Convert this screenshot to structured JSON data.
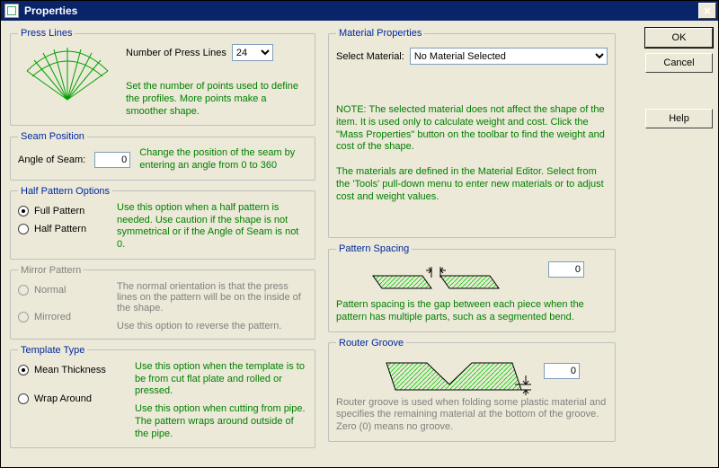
{
  "window": {
    "title": "Properties"
  },
  "buttons": {
    "ok": "OK",
    "cancel": "Cancel",
    "help": "Help"
  },
  "press_lines": {
    "legend": "Press Lines",
    "num_label": "Number of Press Lines",
    "num_value": "24",
    "desc": "Set the number of points used to define the profiles. More points make a smoother shape."
  },
  "seam": {
    "legend": "Seam Position",
    "angle_label": "Angle of Seam:",
    "angle_value": "0",
    "desc": "Change the position of the seam by entering an angle from 0 to 360"
  },
  "half_pattern": {
    "legend": "Half Pattern Options",
    "full_label": "Full Pattern",
    "half_label": "Half Pattern",
    "desc": "Use this option when a half pattern is needed. Use caution if the shape is not symmetrical or if the Angle of Seam is not 0."
  },
  "mirror": {
    "legend": "Mirror Pattern",
    "normal_label": "Normal",
    "mirrored_label": "Mirrored",
    "normal_desc": "The normal orientation is that the press lines on the pattern will be on the inside of the shape.",
    "mirrored_desc": "Use this option to reverse the pattern."
  },
  "template": {
    "legend": "Template Type",
    "mean_label": "Mean Thickness",
    "wrap_label": "Wrap Around",
    "mean_desc": "Use this option when the template is to be from cut flat plate and rolled or pressed.",
    "wrap_desc": "Use this option when cutting from pipe. The pattern wraps around outside of the pipe."
  },
  "material": {
    "legend": "Material Properties",
    "select_label": "Select Material:",
    "selected": "No Material Selected",
    "note": "NOTE: The selected material does not affect the shape of the item. It is used only to calculate weight and cost. Click the \"Mass Properties\" button on the toolbar to find the weight and cost of the shape.",
    "editor_note": "The materials are defined in the Material Editor. Select from the 'Tools' pull-down menu to enter new materials or to adjust cost and weight values."
  },
  "pattern_spacing": {
    "legend": "Pattern Spacing",
    "value": "0",
    "desc": "Pattern spacing is the gap between each piece when the pattern has multiple parts, such as a segmented bend."
  },
  "router": {
    "legend": "Router Groove",
    "value": "0",
    "desc": "Router groove is used when folding some plastic material and specifies the remaining material at the bottom of the groove.  Zero (0) means no groove."
  }
}
